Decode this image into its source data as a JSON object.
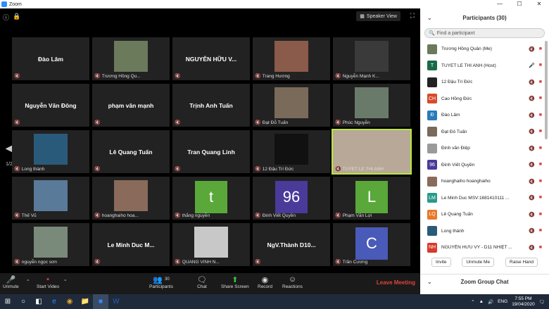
{
  "window": {
    "title": "Zoom"
  },
  "top": {
    "speaker_view": "Speaker View"
  },
  "nav": {
    "left_page": "1/2",
    "right_page": "1/2"
  },
  "tiles": [
    {
      "name": "Đào Lâm",
      "label": "",
      "kind": "name"
    },
    {
      "name": "",
      "label": "Trương Hồng Qu...",
      "kind": "photo",
      "color": "#6b7a5a"
    },
    {
      "name": "NGUYỄN HỮU V...",
      "label": "",
      "kind": "name"
    },
    {
      "name": "",
      "label": "Trang Hương",
      "kind": "photo",
      "color": "#8a5a4a"
    },
    {
      "name": "",
      "label": "Nguyễn Mạnh K...",
      "kind": "photo",
      "color": "#3a3a3a"
    },
    {
      "name": "Nguyễn Văn Đông",
      "label": "",
      "kind": "name"
    },
    {
      "name": "phạm văn mạnh",
      "label": "",
      "kind": "name"
    },
    {
      "name": "Trịnh Anh Tuấn",
      "label": "",
      "kind": "name"
    },
    {
      "name": "",
      "label": "Đạt Đỗ Tuấn",
      "kind": "photo",
      "color": "#7a6a5a"
    },
    {
      "name": "",
      "label": "Phúc Nguyễn",
      "kind": "photo",
      "color": "#6a7a6a"
    },
    {
      "name": "",
      "label": "Long thành",
      "kind": "photo",
      "color": "#2a5a7a"
    },
    {
      "name": "Lê Quang Tuấn",
      "label": "",
      "kind": "name"
    },
    {
      "name": "Tran Quang Linh",
      "label": "",
      "kind": "name"
    },
    {
      "name": "",
      "label": "12 Đậu Trí Đức",
      "kind": "photo",
      "color": "#111111"
    },
    {
      "name": "",
      "label": "TUYET LE THI ANH",
      "kind": "video",
      "color": "#b8a898"
    },
    {
      "name": "",
      "label": "Thế Vũ",
      "kind": "photo",
      "color": "#5a7a9a"
    },
    {
      "name": "",
      "label": "hoanghaiho hoa...",
      "kind": "photo",
      "color": "#8a6a5a"
    },
    {
      "name": "",
      "label": "thắng nguyễn",
      "kind": "letter",
      "letter": "t",
      "color": "#5aa83a"
    },
    {
      "name": "",
      "label": "Đinh Viết Quyền",
      "kind": "letter",
      "letter": "96",
      "color": "#4a3a9a"
    },
    {
      "name": "",
      "label": "Phạm Văn Lợi",
      "kind": "letter",
      "letter": "L",
      "color": "#5aa83a"
    },
    {
      "name": "",
      "label": "nguyễn ngọc sơn",
      "kind": "photo",
      "color": "#7a8a7a"
    },
    {
      "name": "Le Minh Duc M...",
      "label": "",
      "kind": "name"
    },
    {
      "name": "",
      "label": "QUANG VINH N...",
      "kind": "photo",
      "color": "#c8c8c8"
    },
    {
      "name": "NgV.Thành D10...",
      "label": "",
      "kind": "name"
    },
    {
      "name": "",
      "label": "Trần Cương",
      "kind": "letter",
      "letter": "C",
      "color": "#4a5ab8"
    }
  ],
  "toolbar": {
    "unmute": "Unmute",
    "start_video": "Start Video",
    "participants": "Participants",
    "participants_count": "30",
    "chat": "Chat",
    "share_screen": "Share Screen",
    "record": "Record",
    "reactions": "Reactions",
    "leave": "Leave Meeting"
  },
  "panel": {
    "title": "Participants (30)",
    "search_placeholder": "Find a participant",
    "participants": [
      {
        "name": "Trương Hồng Quân (Me)",
        "avatar": "",
        "color": "#6b7a5a"
      },
      {
        "name": "TUYET LE THI ANH (Host)",
        "avatar": "T",
        "color": "#1a6a4a"
      },
      {
        "name": "12 Đậu Trí Đức",
        "avatar": "",
        "color": "#222222"
      },
      {
        "name": "Cao Hồng Đức",
        "avatar": "CH",
        "color": "#d84a2a"
      },
      {
        "name": "Đào Lâm",
        "avatar": "Đ",
        "color": "#2a7ab8"
      },
      {
        "name": "Đạt Đỗ Tuấn",
        "avatar": "",
        "color": "#7a6a5a"
      },
      {
        "name": "Đinh văn Điệp",
        "avatar": "",
        "color": "#9a9a9a"
      },
      {
        "name": "Đinh Viết Quyền",
        "avatar": "96",
        "color": "#4a3a9a"
      },
      {
        "name": "hoanghaiho hoanghaiho",
        "avatar": "",
        "color": "#8a6a5a"
      },
      {
        "name": "Le Minh Duc   MSV:1681410111 ...",
        "avatar": "LM",
        "color": "#2a9a8a"
      },
      {
        "name": "Lê Quang Tuấn",
        "avatar": "LQ",
        "color": "#e8782a"
      },
      {
        "name": "Long thành",
        "avatar": "",
        "color": "#2a5a7a"
      },
      {
        "name": "NGUYỄN HỮU VỸ - D11 NHIỆT ...",
        "avatar": "NH",
        "color": "#d83a2a"
      }
    ],
    "invite": "Invite",
    "unmute_me": "Unmute Me",
    "raise_hand": "Raise Hand",
    "chat_title": "Zoom Group Chat"
  },
  "taskbar": {
    "lang": "ENG",
    "time": "7:55 PM",
    "date": "19/04/2020"
  }
}
